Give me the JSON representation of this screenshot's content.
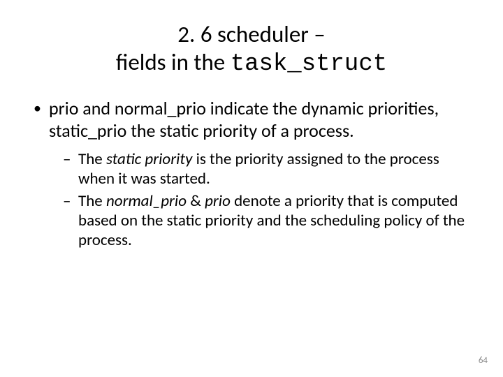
{
  "title": {
    "line1": "2. 6 scheduler –",
    "line2_prefix": "fields in the ",
    "line2_code": "task_struct"
  },
  "bullets": {
    "b1": "prio and normal_prio indicate the dynamic priorities, static_prio the static priority of a process.",
    "sub": {
      "s1_a": "The ",
      "s1_b": "static priority",
      "s1_c": " is the priority assigned to the process when it was started.",
      "s2_a": "The ",
      "s2_b": "normal_prio",
      "s2_c": " & ",
      "s2_d": "prio",
      "s2_e": " denote a priority that is computed based on the static priority and the scheduling policy of the process."
    }
  },
  "page_number": "64"
}
